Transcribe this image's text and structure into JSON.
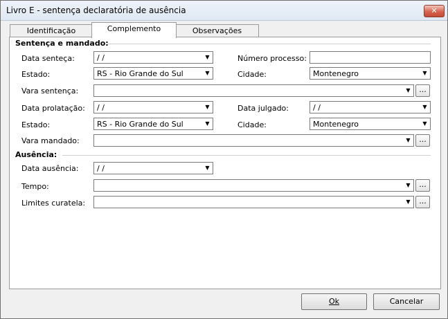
{
  "window": {
    "title": "Livro E - sentença declaratória de ausência",
    "close_glyph": "✕"
  },
  "tabs": [
    {
      "label": "Identificação",
      "active": false
    },
    {
      "label": "Complemento",
      "active": true
    },
    {
      "label": "Observações",
      "active": false
    }
  ],
  "sentenca_mandado": {
    "section_title": "Sentença e mandado:",
    "data_sentenca": {
      "label": "Data senteça:",
      "value": " /  /"
    },
    "numero_processo": {
      "label": "Número processo:",
      "value": ""
    },
    "estado1": {
      "label": "Estado:",
      "value": "RS - Rio Grande do Sul"
    },
    "cidade1": {
      "label": "Cidade:",
      "value": "Montenegro"
    },
    "vara_sentenca": {
      "label": "Vara sentença:",
      "value": ""
    },
    "data_prolatacao": {
      "label": "Data prolatação:",
      "value": " /  /"
    },
    "data_julgado": {
      "label": "Data julgado:",
      "value": " /  /"
    },
    "estado2": {
      "label": "Estado:",
      "value": "RS - Rio Grande do Sul"
    },
    "cidade2": {
      "label": "Cidade:",
      "value": "Montenegro"
    },
    "vara_mandado": {
      "label": "Vara mandado:",
      "value": ""
    }
  },
  "ausencia": {
    "section_title": "Ausência:",
    "data_ausencia": {
      "label": "Data ausência:",
      "value": " /  /"
    },
    "tempo": {
      "label": "Tempo:",
      "value": ""
    },
    "limites_curatela": {
      "label": "Limites curatela:",
      "value": ""
    }
  },
  "ellipsis": "...",
  "dropdown_glyph": "▼",
  "buttons": {
    "ok_label": "Ok",
    "cancel_label": "Cancelar"
  }
}
